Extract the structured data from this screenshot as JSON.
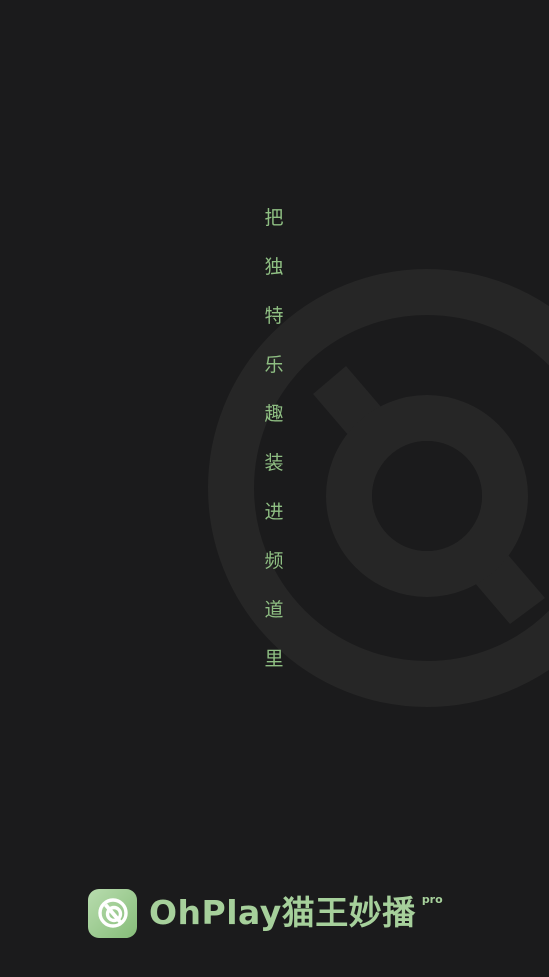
{
  "splash": {
    "slogan_chars": [
      "把",
      "独",
      "特",
      "乐",
      "趣",
      "装",
      "进",
      "频",
      "道",
      "里"
    ],
    "background_icon": "ohplay-logo-watermark-icon"
  },
  "brand": {
    "icon": "ohplay-app-icon",
    "name": "OhPlay猫王妙播",
    "badge": "pro"
  },
  "colors": {
    "background": "#1b1b1c",
    "watermark": "#262626",
    "accent_green": "#a6d09b",
    "slogan_green": "#8fbf83"
  }
}
